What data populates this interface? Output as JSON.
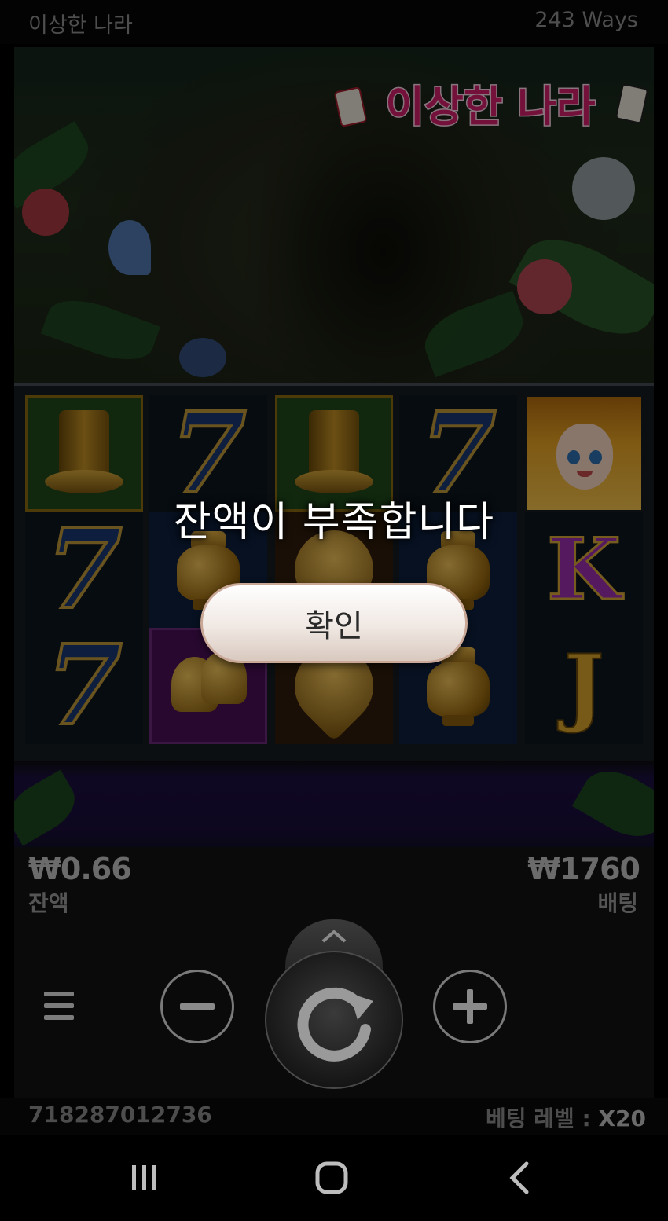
{
  "header": {
    "title": "이상한 나라",
    "ways": "243 Ways"
  },
  "logo": {
    "text": "이상한 나라"
  },
  "reels": [
    [
      "hat",
      "seven",
      "seven"
    ],
    [
      "seven",
      "pot",
      "bell"
    ],
    [
      "hat",
      "spade",
      "spade"
    ],
    [
      "seven",
      "pot",
      "pot"
    ],
    [
      "alice",
      "K",
      "J"
    ]
  ],
  "dialog": {
    "message": "잔액이 부족합니다",
    "confirm_label": "확인"
  },
  "balance": {
    "value": "₩0.66",
    "label": "잔액"
  },
  "bet": {
    "value": "₩1760",
    "label": "배팅"
  },
  "controls": {
    "minus_icon": "minus-icon",
    "plus_icon": "plus-icon",
    "spin_icon": "spin-refresh-icon",
    "menu_icon": "menu-icon",
    "expand_icon": "chevron-up-icon"
  },
  "footer": {
    "round_id": "718287012736",
    "bet_level_label": "베팅 레벨 :",
    "bet_level_value": "X20"
  },
  "colors": {
    "accent_gold": "#c39024",
    "seven_blue": "#1b3872",
    "letter_K": "#9b2fb0",
    "letter_J": "#d9a52a"
  }
}
